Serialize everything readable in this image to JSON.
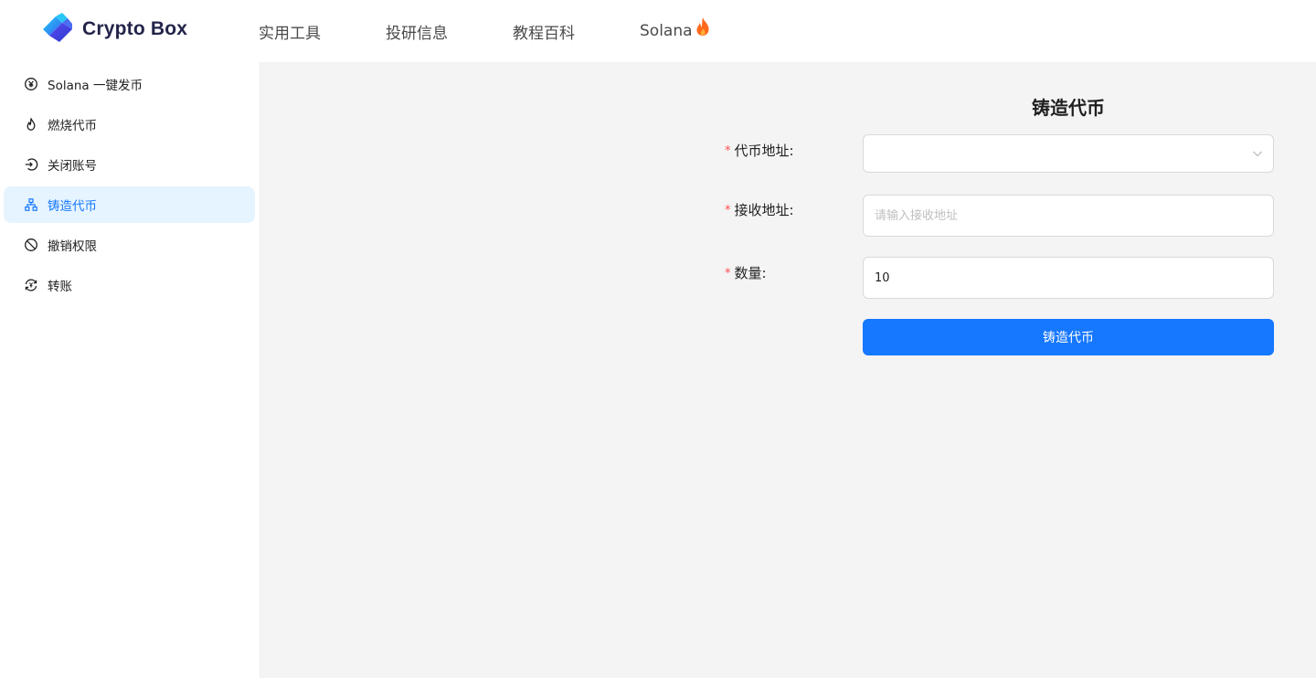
{
  "header": {
    "brand": "Crypto Box",
    "nav": [
      {
        "label": "实用工具"
      },
      {
        "label": "投研信息"
      },
      {
        "label": "教程百科"
      },
      {
        "label": "Solana",
        "icon": "fire-icon"
      }
    ]
  },
  "sidebar": {
    "items": [
      {
        "label": "Solana 一键发币",
        "icon": "yen-coin-icon"
      },
      {
        "label": "燃烧代币",
        "icon": "flame-icon"
      },
      {
        "label": "关闭账号",
        "icon": "logout-icon"
      },
      {
        "label": "铸造代币",
        "icon": "cluster-icon",
        "active": true
      },
      {
        "label": "撤销权限",
        "icon": "stop-icon"
      },
      {
        "label": "转账",
        "icon": "transfer-icon"
      }
    ]
  },
  "form": {
    "title": "铸造代币",
    "token_address": {
      "label": "代币地址:",
      "value": ""
    },
    "receive_address": {
      "label": "接收地址:",
      "placeholder": "请输入接收地址",
      "value": ""
    },
    "amount": {
      "label": "数量:",
      "value": "10"
    },
    "submit_label": "铸造代币"
  },
  "colors": {
    "primary": "#1677ff",
    "active_bg": "#e6f4ff",
    "required": "#ff4d4f",
    "main_bg": "#f4f4f4",
    "fire": "#ff6a1a"
  }
}
